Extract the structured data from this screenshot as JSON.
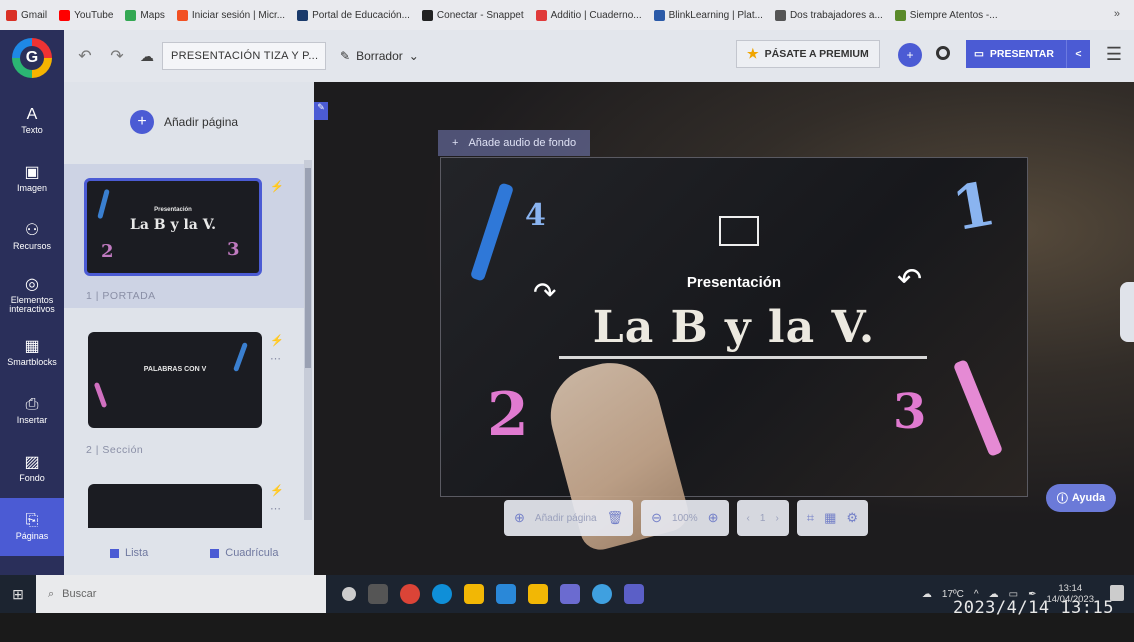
{
  "bookmarks": [
    {
      "label": "Gmail",
      "color": "#d93025"
    },
    {
      "label": "YouTube",
      "color": "#ff0000"
    },
    {
      "label": "Maps",
      "color": "#34a853"
    },
    {
      "label": "Iniciar sesión | Micr...",
      "color": "#f25022"
    },
    {
      "label": "Portal de Educación...",
      "color": "#1a3a6b"
    },
    {
      "label": "Conectar - Snappet",
      "color": "#222222"
    },
    {
      "label": "Additio | Cuaderno...",
      "color": "#e03a3a"
    },
    {
      "label": "BlinkLearning | Plat...",
      "color": "#2b5aa8"
    },
    {
      "label": "Dos trabajadores a...",
      "color": "#555555"
    },
    {
      "label": "Siempre Atentos -...",
      "color": "#5a8a2a"
    }
  ],
  "bookmarks_more": "»",
  "rail": {
    "items": [
      {
        "icon": "A",
        "label": "Texto"
      },
      {
        "icon": "▣",
        "label": "Imagen"
      },
      {
        "icon": "⚇",
        "label": "Recursos"
      },
      {
        "icon": "◎",
        "label": "Elementos interactivos"
      },
      {
        "icon": "▦",
        "label": "Smartblocks"
      },
      {
        "icon": "⎙",
        "label": "Insertar"
      },
      {
        "icon": "▨",
        "label": "Fondo"
      },
      {
        "icon": "⎘",
        "label": "Páginas"
      }
    ]
  },
  "toolbar": {
    "title": "PRESENTACIÓN TIZA Y P...",
    "draft_label": "Borrador",
    "premium_label": "PÁSATE A PREMIUM",
    "present_label": "PRESENTAR"
  },
  "pages_panel": {
    "add_page_label": "Añadir página",
    "pages": [
      {
        "label": "1 | PORTADA",
        "thumb_title": "La B y la V.",
        "thumb_sub": "Presentación"
      },
      {
        "label": "2 | Sección",
        "thumb_title": "PALABRAS CON V",
        "thumb_sub": ""
      },
      {
        "label": "",
        "thumb_title": "",
        "thumb_sub": ""
      }
    ],
    "view_list": "Lista",
    "view_grid": "Cuadrícula"
  },
  "canvas": {
    "audio_label": "Añade audio de fondo",
    "slide_subtitle": "Presentación",
    "slide_title": "La B y la V.",
    "numbers": [
      "1",
      "2",
      "3",
      "4"
    ],
    "help_label": "Ayuda",
    "bottom_add_page": "Añadir página",
    "zoom": "100%",
    "page_number": "1"
  },
  "taskbar": {
    "search_placeholder": "Buscar",
    "temperature": "17ºC",
    "time": "13:14",
    "date": "14/04/2023"
  },
  "photo_timestamp": "2023/4/14 13:15"
}
